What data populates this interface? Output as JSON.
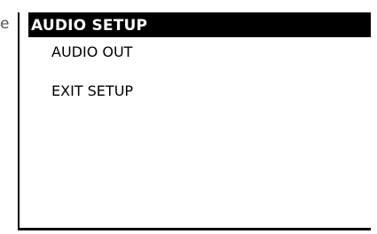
{
  "stray_text": "e",
  "menu": {
    "title": "AUDIO SETUP",
    "items": [
      {
        "label": "AUDIO OUT"
      },
      {
        "label": "EXIT SETUP"
      }
    ]
  },
  "colors": {
    "background": "#ffffff",
    "title_bar": "#000000",
    "title_text": "#ffffff",
    "item_text": "#000000"
  }
}
